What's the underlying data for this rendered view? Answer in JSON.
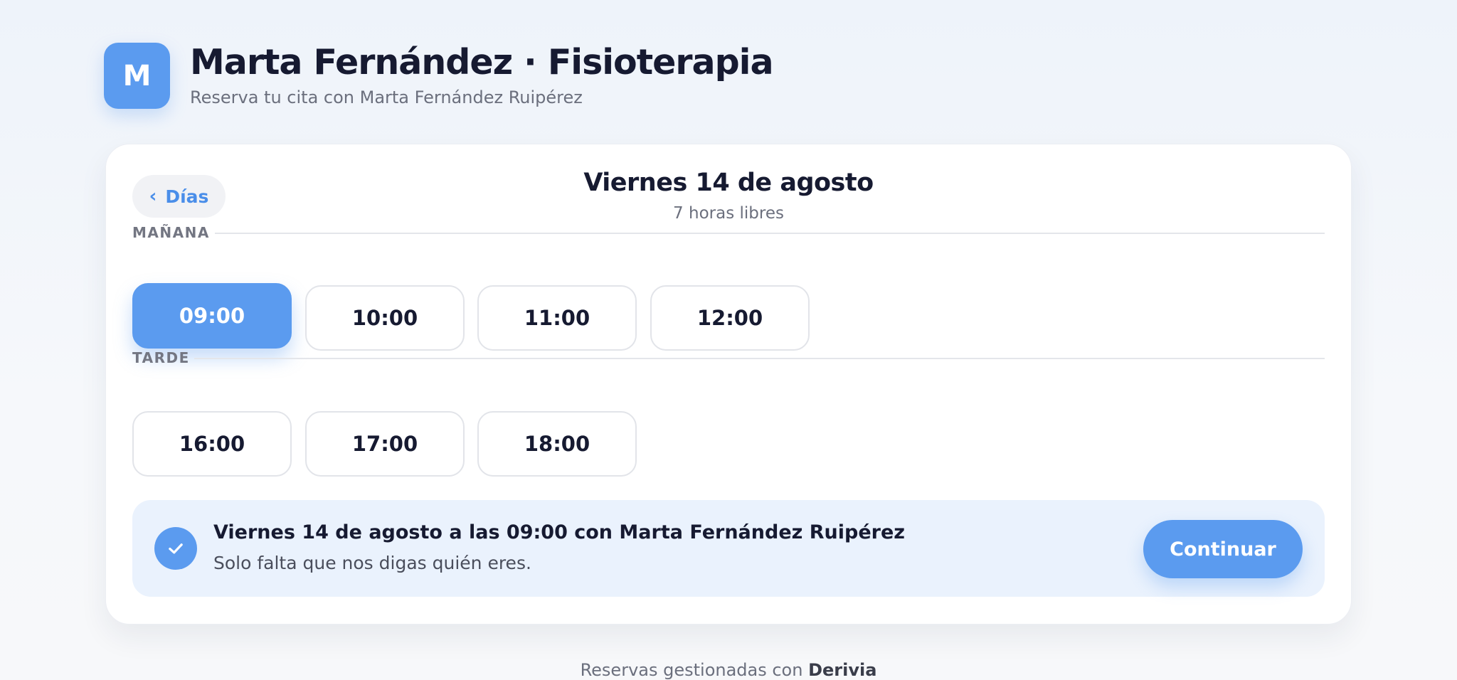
{
  "header": {
    "logo_letter": "M",
    "title": "Marta Fernández · Fisioterapia",
    "subtitle": "Reserva tu cita con Marta Fernández Ruipérez"
  },
  "card": {
    "back_label": "Días",
    "day_title": "Viernes 14 de agosto",
    "day_sub": "7 horas libres",
    "sections": [
      {
        "label": "MAÑANA",
        "slots": [
          "09:00",
          "10:00",
          "11:00",
          "12:00"
        ]
      },
      {
        "label": "TARDE",
        "slots": [
          "16:00",
          "17:00",
          "18:00"
        ]
      }
    ],
    "selected_slot": "09:00"
  },
  "summary": {
    "main": "Viernes 14 de agosto a las 09:00 con Marta Fernández Ruipérez",
    "sub": "Solo falta que nos digas quién eres.",
    "continue_label": "Continuar"
  },
  "footer": {
    "prefix": "Reservas gestionadas con",
    "brand": "Derivia"
  },
  "colors": {
    "accent": "#5b9bef",
    "summary_bg": "#eaf2fd"
  }
}
